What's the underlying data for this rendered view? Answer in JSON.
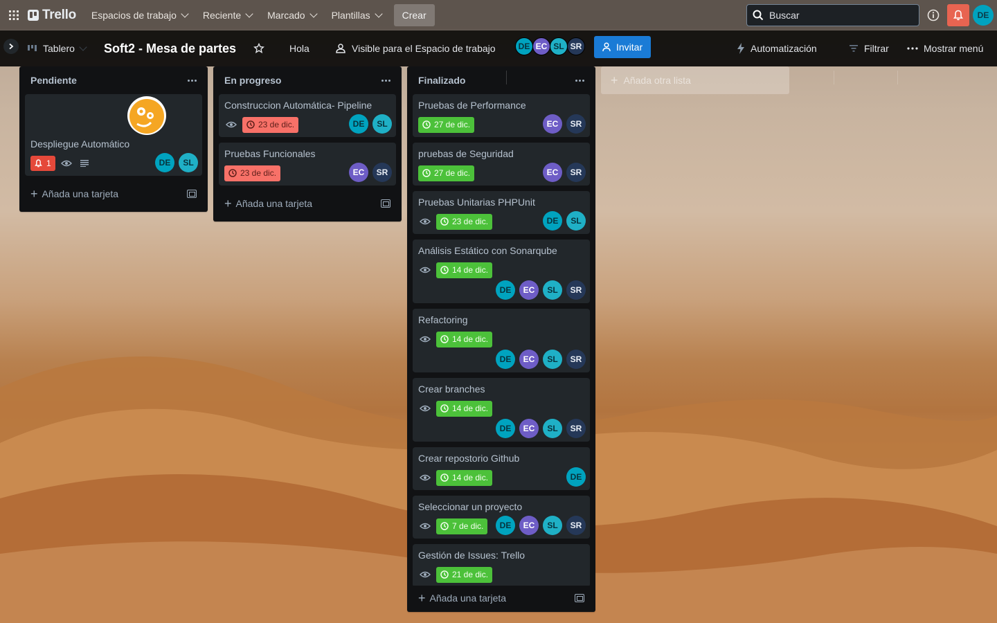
{
  "topbar": {
    "app_name": "Trello",
    "menus": [
      "Espacios de trabajo",
      "Reciente",
      "Marcado",
      "Plantillas"
    ],
    "create_label": "Crear",
    "search_placeholder": "Buscar",
    "user_initials": "DE"
  },
  "boardbar": {
    "view_label": "Tablero",
    "board_title": "Soft2 - Mesa de partes",
    "hola_label": "Hola",
    "visibility_label": "Visible para el Espacio de trabajo",
    "members": [
      "DE",
      "EC",
      "SL",
      "SR"
    ],
    "invite_label": "Invitar",
    "automation_label": "Automatización",
    "filter_label": "Filtrar",
    "menu_label": "Mostrar menú"
  },
  "lists": [
    {
      "title": "Pendiente",
      "add_label": "Añada una tarjeta",
      "cards": [
        {
          "title": "Despliegue Automático",
          "notifications": "1",
          "members": [
            "DE",
            "SL"
          ]
        }
      ]
    },
    {
      "title": "En progreso",
      "add_label": "Añada una tarjeta",
      "cards": [
        {
          "title": "Construccion Automática- Pipeline",
          "date": "23 de dic.",
          "members": [
            "DE",
            "SL"
          ]
        },
        {
          "title": "Pruebas Funcionales",
          "date": "23 de dic.",
          "members": [
            "EC",
            "SR"
          ]
        }
      ]
    },
    {
      "title": "Finalizado",
      "add_label": "Añada una tarjeta",
      "cards": [
        {
          "title": "Pruebas de Performance",
          "date": "27 de dic.",
          "members": [
            "EC",
            "SR"
          ]
        },
        {
          "title": "pruebas de Seguridad",
          "date": "27 de dic.",
          "members": [
            "EC",
            "SR"
          ]
        },
        {
          "title": "Pruebas Unitarias PHPUnit",
          "date": "23 de dic.",
          "members": [
            "DE",
            "SL"
          ]
        },
        {
          "title": "Análisis Estático con Sonarqube",
          "date": "14 de dic.",
          "members": [
            "DE",
            "EC",
            "SL",
            "SR"
          ]
        },
        {
          "title": "Refactoring",
          "date": "14 de dic.",
          "members": [
            "DE",
            "EC",
            "SL",
            "SR"
          ]
        },
        {
          "title": "Crear branches",
          "date": "14 de dic.",
          "members": [
            "DE",
            "EC",
            "SL",
            "SR"
          ]
        },
        {
          "title": "Crear repostorio Github",
          "date": "14 de dic.",
          "members": [
            "DE"
          ]
        },
        {
          "title": "Seleccionar un proyecto",
          "date": "7 de dic.",
          "members": [
            "DE",
            "EC",
            "SL",
            "SR"
          ]
        },
        {
          "title": "Gestión de Issues: Trello",
          "date": "21 de dic.",
          "members": []
        }
      ]
    }
  ],
  "add_list_label": "Añada otra lista",
  "colors": {
    "accent": "#1a7bd6",
    "date_overdue": "#f87168",
    "date_done": "#4cc13a",
    "notification": "#e86451"
  }
}
